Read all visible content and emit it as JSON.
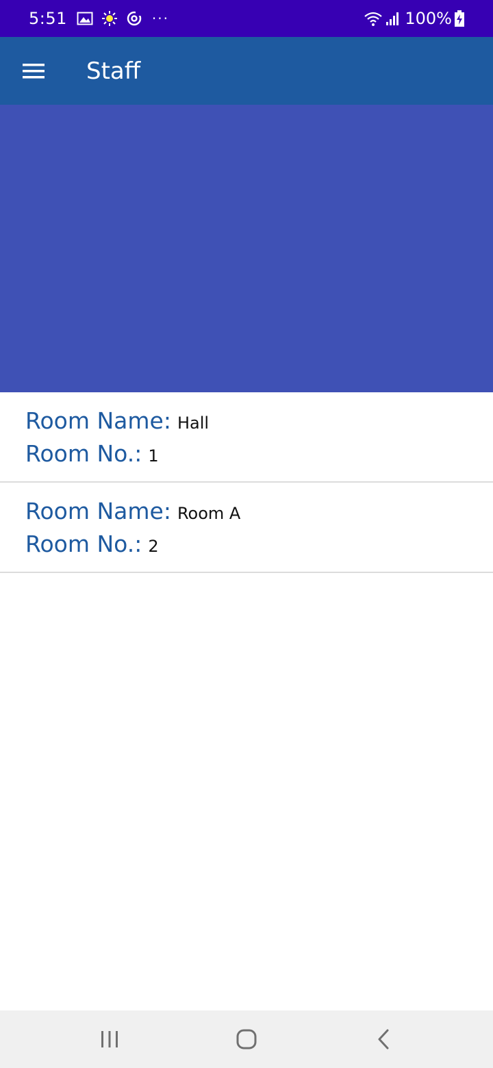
{
  "status_bar": {
    "time": "5:51",
    "more": "···",
    "battery": "100%",
    "icons": [
      "image-icon",
      "sun-icon",
      "sync-icon",
      "wifi-icon",
      "signal-icon",
      "battery-charging-icon"
    ]
  },
  "app_bar": {
    "title": "Staff",
    "menu_icon": "menu-icon"
  },
  "colors": {
    "status_bar": "#3700b3",
    "app_bar": "#1e5aa0",
    "hero": "#3f51b5",
    "label": "#1e5aa0"
  },
  "rooms": [
    {
      "name_label": "Room Name:",
      "name": "Hall",
      "no_label": "Room No.:",
      "no": "1"
    },
    {
      "name_label": "Room Name:",
      "name": "Room A",
      "no_label": "Room No.:",
      "no": "2"
    }
  ],
  "nav_bar": {
    "icons": [
      "recent-apps-icon",
      "home-icon",
      "back-icon"
    ]
  }
}
